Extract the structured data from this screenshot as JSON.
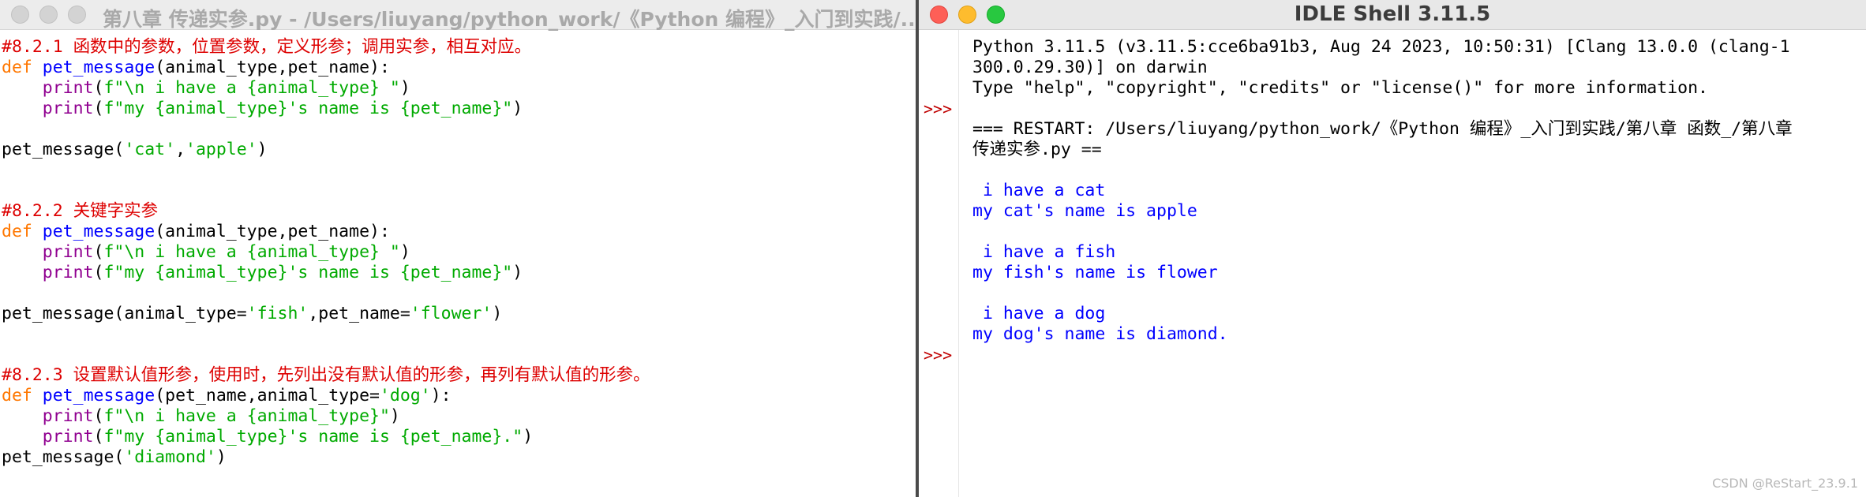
{
  "editor": {
    "title": "第八章 传递实参.py - /Users/liuyang/python_work/《Python 编程》_入门到实践/...",
    "lines": [
      [
        {
          "t": "#8.2.1 函数中的参数，位置参数，定义形参；调用实参，相互对应。",
          "k": "comment"
        }
      ],
      [
        {
          "t": "def",
          "k": "keyword"
        },
        {
          "t": " ",
          "k": "plain"
        },
        {
          "t": "pet_message",
          "k": "def"
        },
        {
          "t": "(animal_type,pet_name):",
          "k": "plain"
        }
      ],
      [
        {
          "t": "    ",
          "k": "plain"
        },
        {
          "t": "print",
          "k": "builtin"
        },
        {
          "t": "(",
          "k": "plain"
        },
        {
          "t": "f\"\\n i have a {animal_type} \"",
          "k": "string"
        },
        {
          "t": ")",
          "k": "plain"
        }
      ],
      [
        {
          "t": "    ",
          "k": "plain"
        },
        {
          "t": "print",
          "k": "builtin"
        },
        {
          "t": "(",
          "k": "plain"
        },
        {
          "t": "f\"my {animal_type}'s name is {pet_name}\"",
          "k": "string"
        },
        {
          "t": ")",
          "k": "plain"
        }
      ],
      [],
      [
        {
          "t": "pet_message(",
          "k": "plain"
        },
        {
          "t": "'cat'",
          "k": "string"
        },
        {
          "t": ",",
          "k": "plain"
        },
        {
          "t": "'apple'",
          "k": "string"
        },
        {
          "t": ")",
          "k": "plain"
        }
      ],
      [],
      [],
      [
        {
          "t": "#8.2.2 关键字实参",
          "k": "comment"
        }
      ],
      [
        {
          "t": "def",
          "k": "keyword"
        },
        {
          "t": " ",
          "k": "plain"
        },
        {
          "t": "pet_message",
          "k": "def"
        },
        {
          "t": "(animal_type,pet_name):",
          "k": "plain"
        }
      ],
      [
        {
          "t": "    ",
          "k": "plain"
        },
        {
          "t": "print",
          "k": "builtin"
        },
        {
          "t": "(",
          "k": "plain"
        },
        {
          "t": "f\"\\n i have a {animal_type} \"",
          "k": "string"
        },
        {
          "t": ")",
          "k": "plain"
        }
      ],
      [
        {
          "t": "    ",
          "k": "plain"
        },
        {
          "t": "print",
          "k": "builtin"
        },
        {
          "t": "(",
          "k": "plain"
        },
        {
          "t": "f\"my {animal_type}'s name is {pet_name}\"",
          "k": "string"
        },
        {
          "t": ")",
          "k": "plain"
        }
      ],
      [],
      [
        {
          "t": "pet_message(animal_type=",
          "k": "plain"
        },
        {
          "t": "'fish'",
          "k": "string"
        },
        {
          "t": ",pet_name=",
          "k": "plain"
        },
        {
          "t": "'flower'",
          "k": "string"
        },
        {
          "t": ")",
          "k": "plain"
        }
      ],
      [],
      [],
      [
        {
          "t": "#8.2.3 设置默认值形参，使用时，先列出没有默认值的形参，再列有默认值的形参。",
          "k": "comment"
        }
      ],
      [
        {
          "t": "def",
          "k": "keyword"
        },
        {
          "t": " ",
          "k": "plain"
        },
        {
          "t": "pet_message",
          "k": "def"
        },
        {
          "t": "(pet_name,animal_type=",
          "k": "plain"
        },
        {
          "t": "'dog'",
          "k": "string"
        },
        {
          "t": "):",
          "k": "plain"
        }
      ],
      [
        {
          "t": "    ",
          "k": "plain"
        },
        {
          "t": "print",
          "k": "builtin"
        },
        {
          "t": "(",
          "k": "plain"
        },
        {
          "t": "f\"\\n i have a {animal_type}\"",
          "k": "string"
        },
        {
          "t": ")",
          "k": "plain"
        }
      ],
      [
        {
          "t": "    ",
          "k": "plain"
        },
        {
          "t": "print",
          "k": "builtin"
        },
        {
          "t": "(",
          "k": "plain"
        },
        {
          "t": "f\"my {animal_type}'s name is {pet_name}.\"",
          "k": "string"
        },
        {
          "t": ")",
          "k": "plain"
        }
      ],
      [
        {
          "t": "pet_message(",
          "k": "plain"
        },
        {
          "t": "'diamond'",
          "k": "string"
        },
        {
          "t": ")",
          "k": "plain"
        }
      ]
    ]
  },
  "shell": {
    "title": "IDLE Shell 3.11.5",
    "prompt": ">>>",
    "prompt_lines": [
      3,
      15
    ],
    "lines": [
      {
        "t": "Python 3.11.5 (v3.11.5:cce6ba91b3, Aug 24 2023, 10:50:31) [Clang 13.0.0 (clang-1",
        "k": "plain"
      },
      {
        "t": "300.0.29.30)] on darwin",
        "k": "plain"
      },
      {
        "t": "Type \"help\", \"copyright\", \"credits\" or \"license()\" for more information.",
        "k": "plain"
      },
      {
        "t": "",
        "k": "plain"
      },
      {
        "t": "=== RESTART: /Users/liuyang/python_work/《Python 编程》_入门到实践/第八章 函数_/第八章",
        "k": "plain"
      },
      {
        "t": "传递实参.py ==",
        "k": "plain"
      },
      {
        "t": "",
        "k": "plain"
      },
      {
        "t": " i have a cat",
        "k": "out"
      },
      {
        "t": "my cat's name is apple",
        "k": "out"
      },
      {
        "t": "",
        "k": "plain"
      },
      {
        "t": " i have a fish",
        "k": "out"
      },
      {
        "t": "my fish's name is flower",
        "k": "out"
      },
      {
        "t": "",
        "k": "plain"
      },
      {
        "t": " i have a dog",
        "k": "out"
      },
      {
        "t": "my dog's name is diamond.",
        "k": "out"
      }
    ]
  },
  "watermark": "CSDN @ReStart_23.9.1",
  "colors": {
    "comment": "#dd0000",
    "keyword": "#ff7700",
    "def": "#0000ff",
    "builtin": "#900090",
    "string": "#00aa00",
    "shell_output": "#0000ff",
    "prompt": "#c00000"
  }
}
